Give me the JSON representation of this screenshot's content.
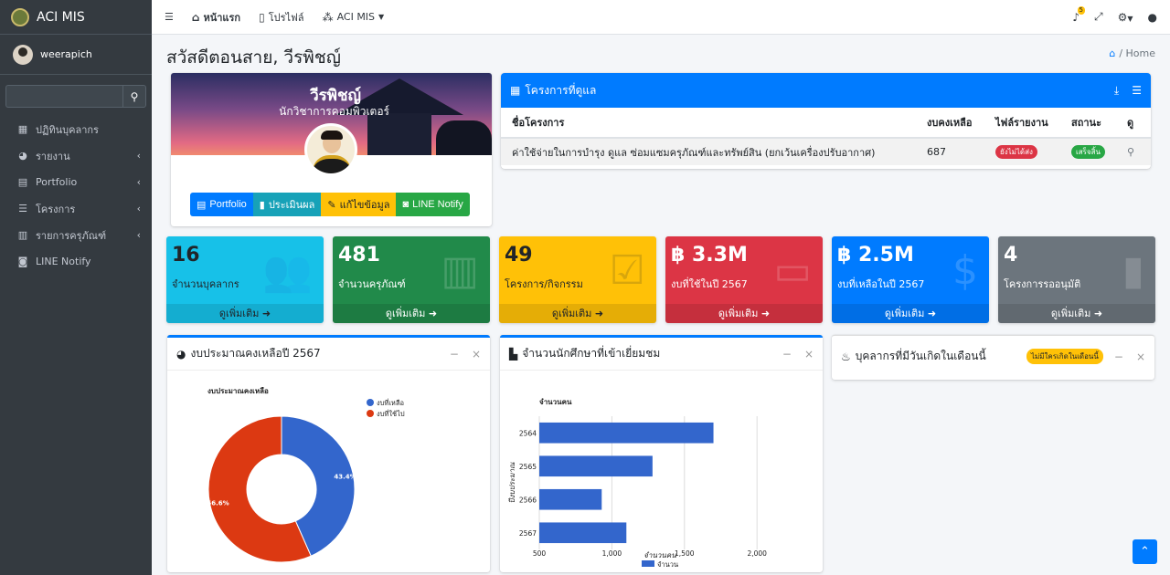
{
  "brand": {
    "title": "ACI MIS"
  },
  "user": {
    "name": "weerapich"
  },
  "sidebar": {
    "search_placeholder": "",
    "items": [
      {
        "label": "ปฏิทินบุคลากร",
        "icon": "calendar-icon",
        "arrow": ""
      },
      {
        "label": "รายงาน",
        "icon": "chart-pie-icon",
        "arrow": "‹"
      },
      {
        "label": "Portfolio",
        "icon": "id-card-icon",
        "arrow": "‹"
      },
      {
        "label": "โครงการ",
        "icon": "list-icon",
        "arrow": "‹"
      },
      {
        "label": "รายการครุภัณฑ์",
        "icon": "warehouse-icon",
        "arrow": "‹"
      },
      {
        "label": "LINE Notify",
        "icon": "line-icon",
        "arrow": ""
      }
    ]
  },
  "topbar": {
    "links": [
      "หน้าแรก",
      "โปรไฟล์",
      "ACI MIS"
    ],
    "notif_count": "5"
  },
  "header": {
    "title": "สวัสดีตอนสาย, วีรพิชญ์",
    "breadcrumb": "Home"
  },
  "profile": {
    "name": "วีรพิชญ์",
    "role": "นักวิชาการคอมพิวเตอร์",
    "buttons": [
      "Portfolio",
      "ประเมินผล",
      "แก้ไขข้อมูล",
      "LINE Notify"
    ]
  },
  "projects": {
    "title": "โครงการที่ดูแล",
    "headers": [
      "ชื่อโครงการ",
      "งบคงเหลือ",
      "ไฟล์รายงาน",
      "สถานะ",
      "ดู"
    ],
    "rows": [
      {
        "name": "ค่าใช้จ่ายในการบำรุง ดูแล ซ่อมแซมครุภัณฑ์และทรัพย์สิน (ยกเว้นเครื่องปรับอากาศ)",
        "budget": "687",
        "report": "ยังไม่ได้ส่ง",
        "status": "เสร็จสิ้น"
      }
    ]
  },
  "stats": [
    {
      "value": "16",
      "label": "จำนวนบุคลากร",
      "more": "ดูเพิ่มเติม",
      "color": "#17c1e8",
      "fg": "#212529",
      "icon": "users-icon"
    },
    {
      "value": "481",
      "label": "จำนวนครุภัณฑ์",
      "more": "ดูเพิ่มเติม",
      "color": "#218a4a",
      "fg": "#ffffff",
      "icon": "warehouse-icon"
    },
    {
      "value": "49",
      "label": "โครงการ/กิจกรรม",
      "more": "ดูเพิ่มเติม",
      "color": "#ffc107",
      "fg": "#212529",
      "icon": "tasks-icon"
    },
    {
      "value": "฿ 3.3M",
      "label": "งบที่ใช้ในปี 2567",
      "more": "ดูเพิ่มเติม",
      "color": "#dc3545",
      "fg": "#ffffff",
      "icon": "money-icon"
    },
    {
      "value": "฿ 2.5M",
      "label": "งบที่เหลือในปี 2567",
      "more": "ดูเพิ่มเติม",
      "color": "#007bff",
      "fg": "#ffffff",
      "icon": "hand-dollar-icon"
    },
    {
      "value": "4",
      "label": "โครงการรออนุมัติ",
      "more": "ดูเพิ่มเติม",
      "color": "#6c757d",
      "fg": "#ffffff",
      "icon": "file-icon"
    }
  ],
  "panels": {
    "budget_title": "งบประมาณคงเหลือปี 2567",
    "visits_title": "จำนวนนักศึกษาที่เข้าเยี่ยมชม",
    "birthday_title": "บุคลากรที่มีวันเกิดในเดือนนี้",
    "birthday_badge": "ไม่มีใครเกิดในเดือนนี้"
  },
  "chart_data": [
    {
      "type": "pie",
      "title": "งบประมาณคงเหลือ",
      "categories": [
        "งบที่เหลือ",
        "งบที่ใช้ไป"
      ],
      "values": [
        43.4,
        56.6
      ],
      "data_labels": [
        "43.4%",
        "56.6%"
      ],
      "colors": [
        "#3366cc",
        "#dc3912"
      ],
      "legend": "top-right"
    },
    {
      "type": "bar",
      "orientation": "horizontal",
      "title": "จำนวนคน",
      "categories": [
        "2564",
        "2565",
        "2566",
        "2567"
      ],
      "series": [
        {
          "name": "จำนวน",
          "values": [
            1700,
            1280,
            930,
            1100
          ]
        }
      ],
      "xlabel": "จำนวนคน",
      "ylabel": "ปีงบประมาณ",
      "xlim": [
        500,
        2150
      ],
      "xticks": [
        "500",
        "1,000",
        "1,500",
        "2,000"
      ],
      "xtick_values": [
        500,
        1000,
        1500,
        2000
      ],
      "grid": true,
      "legend": "bottom",
      "color": "#3366cc"
    }
  ]
}
